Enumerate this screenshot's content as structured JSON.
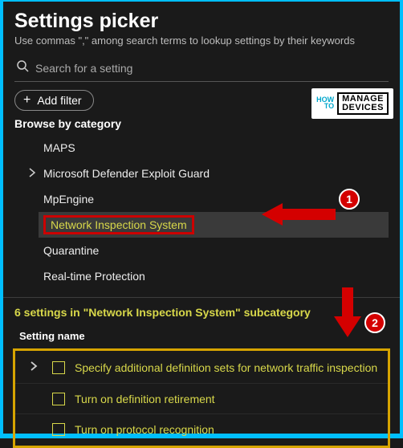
{
  "header": {
    "title": "Settings picker",
    "subtitle": "Use commas \",\" among search terms to lookup settings by their keywords"
  },
  "search": {
    "placeholder": "Search for a setting"
  },
  "filter": {
    "add_label": "Add filter"
  },
  "browse": {
    "heading": "Browse by category",
    "items": [
      {
        "label": "MAPS",
        "expandable": false
      },
      {
        "label": "Microsoft Defender Exploit Guard",
        "expandable": true
      },
      {
        "label": "MpEngine",
        "expandable": false
      },
      {
        "label": "Network Inspection System",
        "expandable": false,
        "selected": true
      },
      {
        "label": "Quarantine",
        "expandable": false
      },
      {
        "label": "Real-time Protection",
        "expandable": false
      }
    ]
  },
  "results": {
    "count_line": "6 settings in \"Network Inspection System\" subcategory",
    "column_header": "Setting name",
    "rows": [
      {
        "label": "Specify additional definition sets for network traffic inspection",
        "expandable": true
      },
      {
        "label": "Turn on definition retirement",
        "expandable": false
      },
      {
        "label": "Turn on protocol recognition",
        "expandable": false
      }
    ]
  },
  "annotations": {
    "badge1": "1",
    "badge2": "2"
  },
  "logo": {
    "left": "HOW\nTO",
    "right_top": "MANAGE",
    "right_bottom": "DEVICES"
  }
}
